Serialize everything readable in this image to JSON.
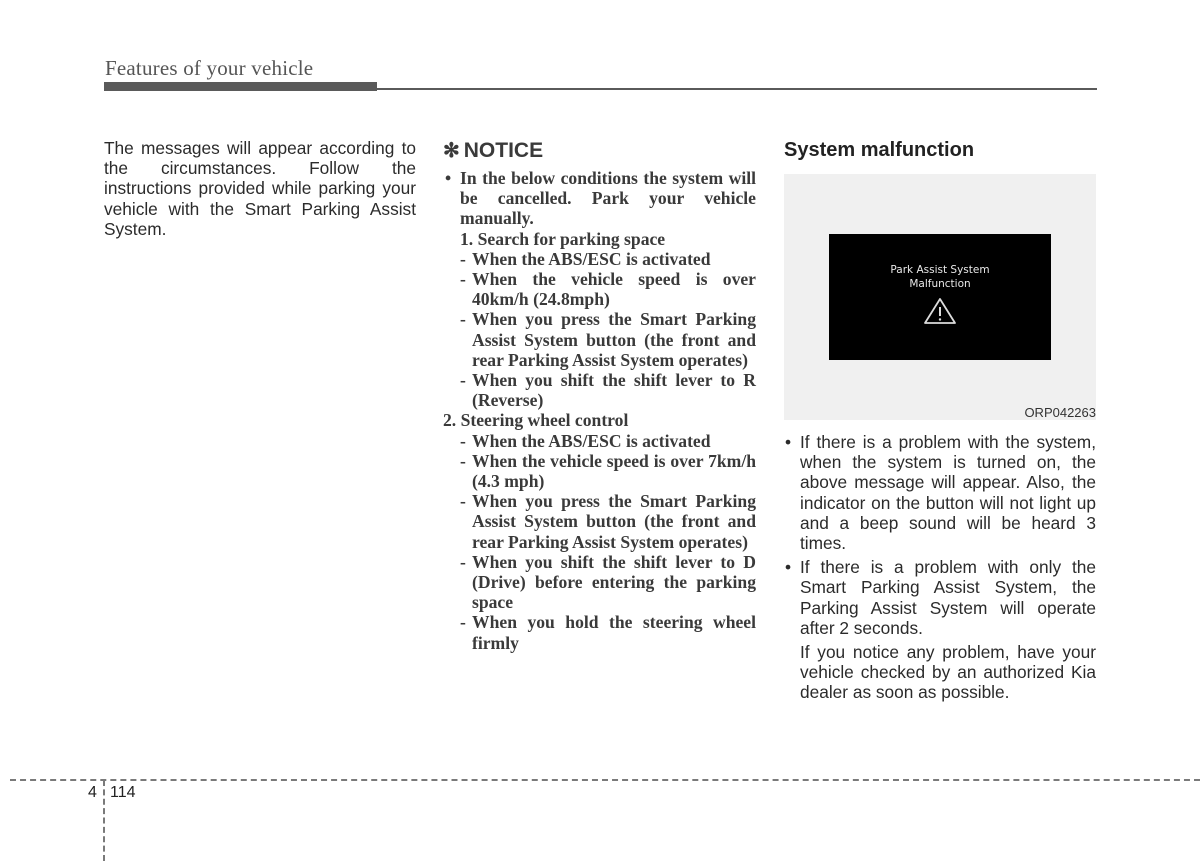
{
  "header": {
    "title": "Features of your vehicle"
  },
  "left_column": {
    "paragraph": "The messages will appear according to the circumstances. Follow the instructions provided while parking your vehicle with the Smart Parking Assist System."
  },
  "notice": {
    "icon": "asterisk-icon",
    "star": "✻",
    "heading": "NOTICE",
    "bullet_symbol": "•",
    "intro": "In the below conditions the system will be cancelled. Park your vehicle manually.",
    "sections": [
      {
        "title": "1. Search for parking space",
        "items": [
          "When the ABS/ESC is activated",
          "When the vehicle speed is over 40km/h (24.8mph)",
          "When you press the Smart Parking Assist System button (the front and rear Parking Assist System operates)",
          "When you shift the shift lever to R (Reverse)"
        ]
      },
      {
        "title": "2. Steering wheel control",
        "items": [
          "When the ABS/ESC is activated",
          "When the vehicle speed is over 7km/h (4.3 mph)",
          "When you press the Smart Parking Assist System button (the front and rear Parking Assist System operates)",
          "When you shift the shift lever to D (Drive) before entering the parking space",
          "When you hold the steering wheel firmly"
        ]
      }
    ],
    "dash": "-"
  },
  "right_column": {
    "heading": "System malfunction",
    "figure": {
      "screen_line1": "Park Assist System",
      "screen_line2": "Malfunction",
      "icon": "warning-triangle-icon",
      "code": "ORP042263"
    },
    "bullet_symbol": "•",
    "bullets": [
      "If there is a problem with the system, when the system is turned on, the above message will appear. Also, the indicator on the button will not light up and a beep sound will be heard 3 times.",
      "If there is a problem with only the Smart Parking Assist System, the Parking Assist System will operate after 2 seconds."
    ],
    "closing": "If you notice any problem, have your vehicle checked by an authorized Kia dealer as soon as possible."
  },
  "footer": {
    "chapter": "4",
    "page": "114"
  }
}
